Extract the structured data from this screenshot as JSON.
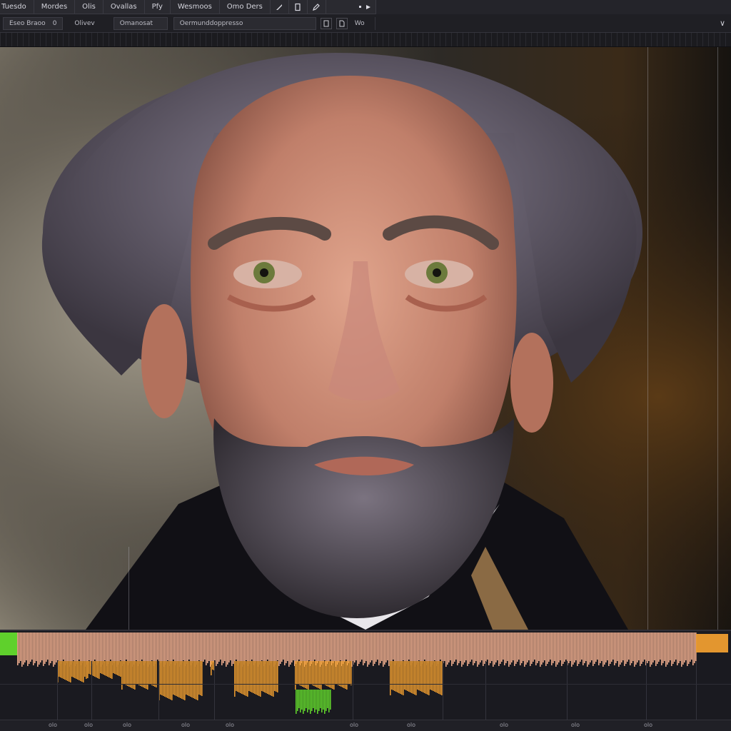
{
  "menubar": {
    "items": [
      "Tuesdo",
      "Mordes",
      "Olis",
      "Ovallas",
      "Pfy",
      "Wesmoos",
      "Omo Ders"
    ],
    "tools": [
      "brush-icon",
      "page-icon",
      "pen-icon"
    ],
    "status_icons": [
      "dot-icon",
      "arrow-icon"
    ]
  },
  "toolbar": {
    "field1": "Eseo Braoo",
    "field1_suffix": "0",
    "label2": "Olivev",
    "field3": "Omanosat",
    "field4": "Oermunddoppresso",
    "icon_label": "Wo",
    "chevron": "∨"
  },
  "timeline": {
    "tick_labels": [
      "olo",
      "olo",
      "olo",
      "olo",
      "olo",
      "olo",
      "olo",
      "olo",
      "olo",
      "olo"
    ],
    "colors": {
      "peak": "#e9a98a",
      "mid": "#e3962f",
      "green": "#5fd02c",
      "bg": "#1a1a20"
    }
  },
  "colors": {
    "menubar_bg": "#2a2a30",
    "toolbar_bg": "#1f1f24",
    "accent": "#e3962f"
  }
}
